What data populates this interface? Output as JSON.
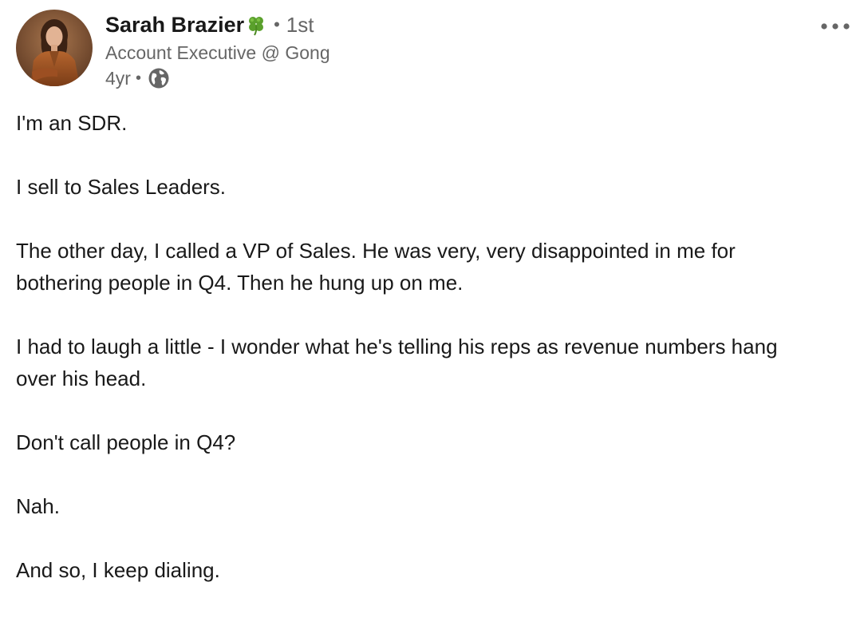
{
  "author": {
    "name": "Sarah Brazier",
    "name_emoji": "four-leaf-clover",
    "separator": "•",
    "degree": "1st",
    "headline": "Account Executive @ Gong",
    "timestamp": "4yr",
    "time_separator": "•",
    "visibility_icon": "globe-icon"
  },
  "menu": {
    "icon": "more-horizontal-icon"
  },
  "post": {
    "paragraphs": [
      "I'm an SDR.",
      "I sell to Sales Leaders.",
      "The other day, I called a VP of Sales. He was very, very disappointed in me for bothering people in Q4. Then he hung up on me.",
      "I had to laugh a little - I wonder what he's telling his reps as revenue numbers hang over his head.",
      "Don't call people in Q4?",
      "Nah.",
      "And so, I keep dialing."
    ]
  },
  "colors": {
    "primary_text": "#191919",
    "secondary_text": "#666666",
    "clover_green": "#5aa02c",
    "background": "#ffffff"
  }
}
